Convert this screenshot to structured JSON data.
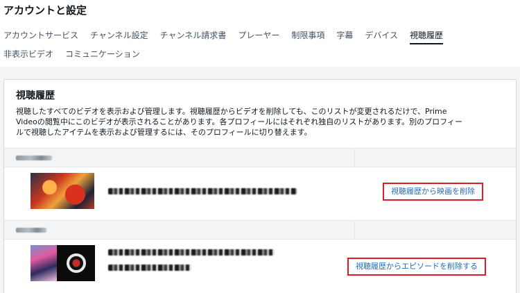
{
  "header": {
    "title": "アカウントと設定"
  },
  "tabs": [
    {
      "label": "アカウントサービス",
      "active": false
    },
    {
      "label": "チャンネル設定",
      "active": false
    },
    {
      "label": "チャンネル請求書",
      "active": false
    },
    {
      "label": "プレーヤー",
      "active": false
    },
    {
      "label": "制限事項",
      "active": false
    },
    {
      "label": "字幕",
      "active": false
    },
    {
      "label": "デバイス",
      "active": false
    },
    {
      "label": "視聴履歴",
      "active": true
    },
    {
      "label": "非表示ビデオ",
      "active": false
    },
    {
      "label": "コミュニケーション",
      "active": false
    }
  ],
  "card": {
    "title": "視聴履歴",
    "description_lines": [
      "視聴したすべてのビデオを表示および管理します。視聴履歴からビデオを削除しても、このリストが変更されるだけで、Prime",
      "Videoの閲覧中にこのビデオが表示されることがあります。各プロフィールにはそれぞれ独自のリストがあります。別のプロフィー",
      "ルで視聴したアイテムを表示および管理するには、そのプロフィールに切り替えます。"
    ]
  },
  "history": [
    {
      "remove_label": "視聴履歴から映画を削除"
    },
    {
      "remove_label": "視聴履歴からエピソードを削除する"
    }
  ],
  "colors": {
    "accent_link": "#1f6db5",
    "highlight_border": "#e01a28",
    "panel_bg": "#f2f4f6"
  }
}
